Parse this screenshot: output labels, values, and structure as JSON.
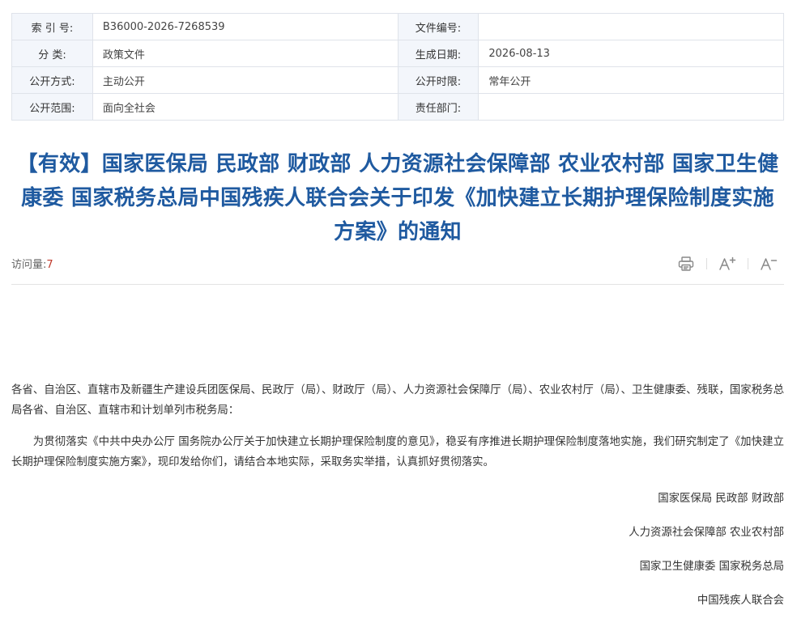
{
  "meta": {
    "rows": [
      {
        "k1": "索 引 号:",
        "v1": "B36000-2026-7268539",
        "k2": "文件编号:",
        "v2": ""
      },
      {
        "k1": "分    类:",
        "v1": "政策文件",
        "k2": "生成日期:",
        "v2": "2026-08-13"
      },
      {
        "k1": "公开方式:",
        "v1": "主动公开",
        "k2": "公开时限:",
        "v2": "常年公开"
      },
      {
        "k1": "公开范围:",
        "v1": "面向全社会",
        "k2": "责任部门:",
        "v2": ""
      }
    ]
  },
  "title": "【有效】国家医保局 民政部 财政部 人力资源社会保障部 农业农村部 国家卫生健康委 国家税务总局中国残疾人联合会关于印发《加快建立长期护理保险制度实施方案》的通知",
  "info": {
    "visits_label": "访问量:",
    "visits_count": "7"
  },
  "icons": {
    "print": "print-icon",
    "font_increase": "font-increase-icon",
    "font_decrease": "font-decrease-icon"
  },
  "body": {
    "addressee": "各省、自治区、直辖市及新疆生产建设兵团医保局、民政厅（局）、财政厅（局）、人力资源社会保障厅（局）、农业农村厅（局）、卫生健康委、残联，国家税务总局各省、自治区、直辖市和计划单列市税务局：",
    "paragraph": "为贯彻落实《中共中央办公厅 国务院办公厅关于加快建立长期护理保险制度的意见》，稳妥有序推进长期护理保险制度落地实施，我们研究制定了《加快建立长期护理保险制度实施方案》，现印发给你们，请结合本地实际，采取务实举措，认真抓好贯彻落实。",
    "signatures": [
      "国家医保局 民政部 财政部",
      "人力资源社会保障部 农业农村部",
      "国家卫生健康委 国家税务总局",
      "中国残疾人联合会"
    ]
  },
  "colors": {
    "title": "#1f5aa0",
    "table_key_bg": "#f3f6fb",
    "visits_count": "#c0392b"
  }
}
